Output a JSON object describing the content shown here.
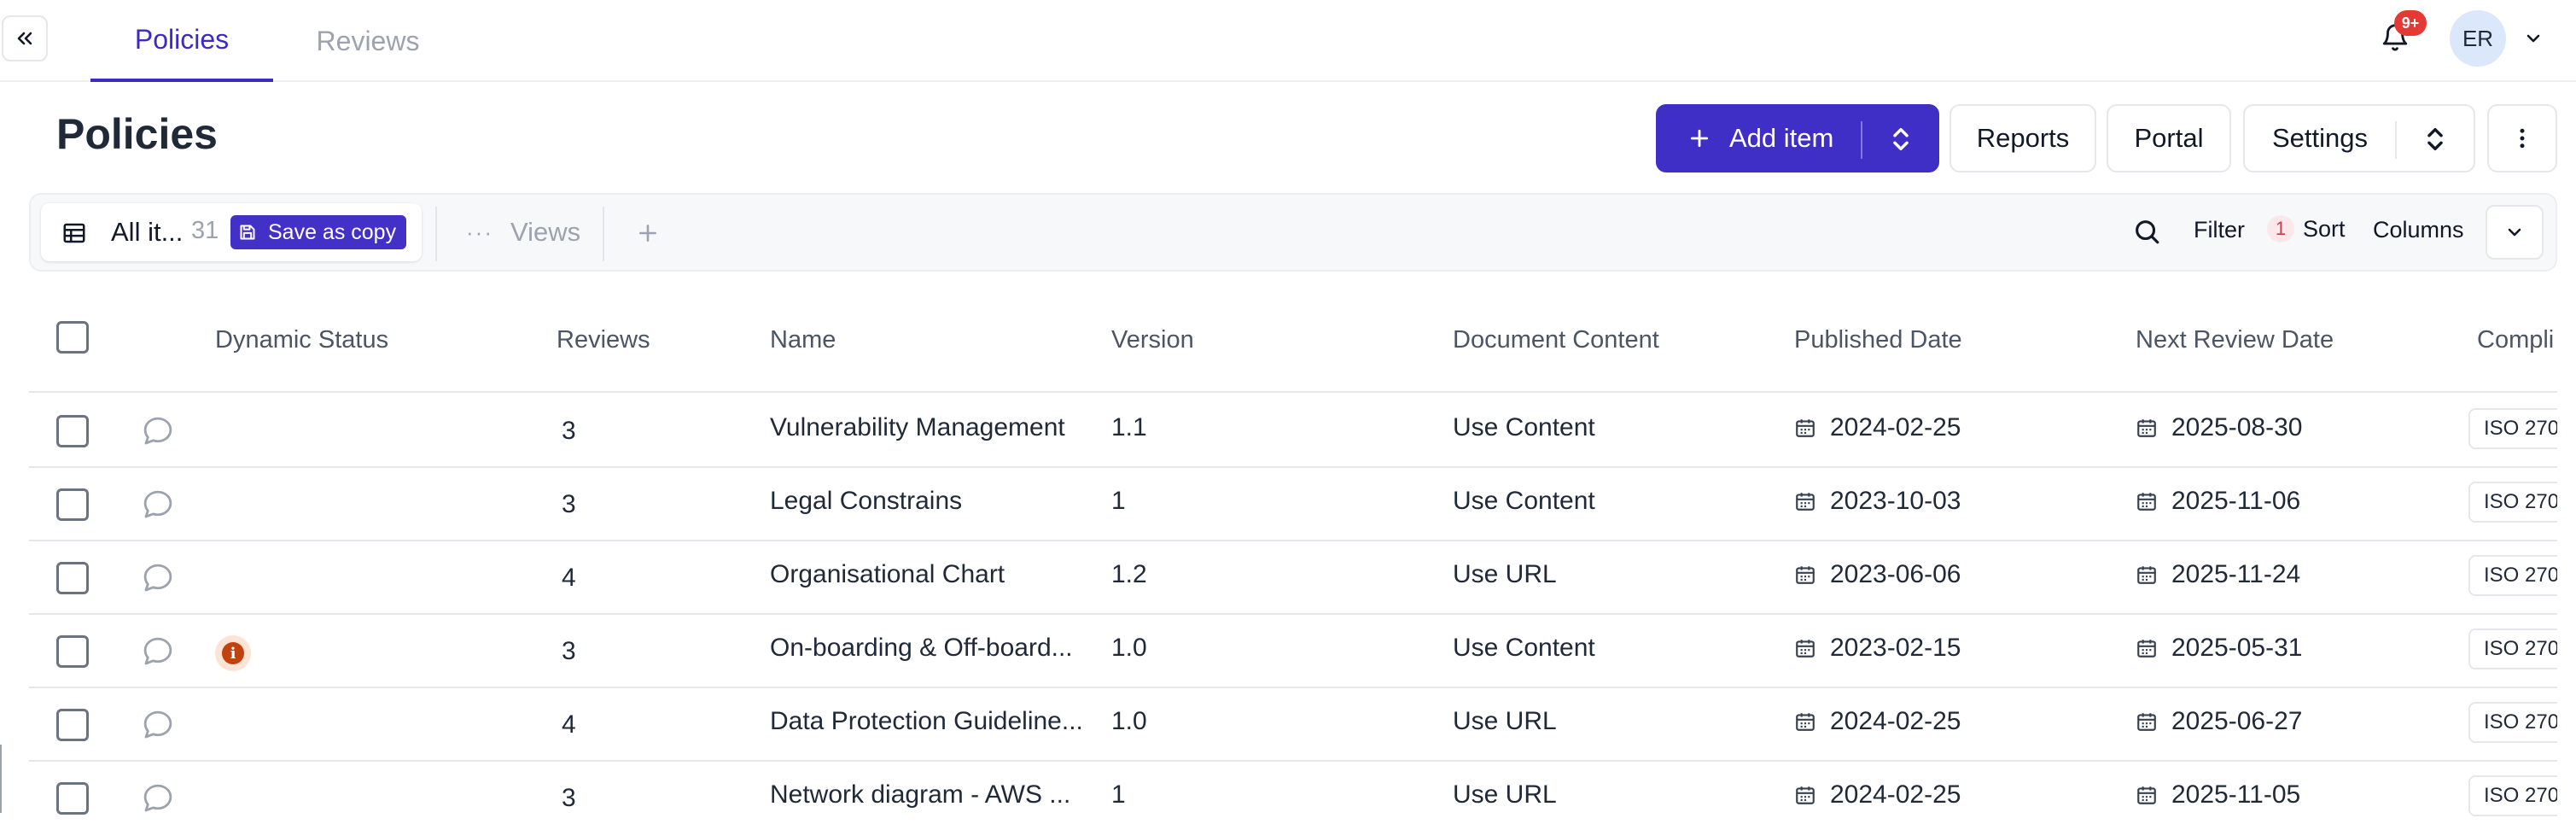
{
  "nav": {
    "collapse_icon": "double-chevron-left-icon",
    "tabs": [
      {
        "label": "Policies",
        "active": true
      },
      {
        "label": "Reviews",
        "active": false
      }
    ],
    "notification_badge": "9+",
    "avatar_initials": "ER"
  },
  "header": {
    "title": "Policies",
    "add_item_label": "Add item",
    "reports_label": "Reports",
    "portal_label": "Portal",
    "settings_label": "Settings"
  },
  "toolbar": {
    "view_name": "All it...",
    "view_count": "31",
    "save_copy_label": "Save as copy",
    "views_label": "Views",
    "filter_label": "Filter",
    "sort_count": "1",
    "sort_label": "Sort",
    "columns_label": "Columns"
  },
  "table": {
    "columns": [
      "Dynamic Status",
      "Reviews",
      "Name",
      "Version",
      "Document Content",
      "Published Date",
      "Next Review Date",
      "Compli"
    ],
    "rows": [
      {
        "status_icon": "",
        "reviews": "3",
        "name": "Vulnerability Management",
        "version": "1.1",
        "content": "Use Content",
        "published": "2024-02-25",
        "next_review": "2025-08-30",
        "compliance": "ISO 270"
      },
      {
        "status_icon": "",
        "reviews": "3",
        "name": "Legal Constrains",
        "version": "1",
        "content": "Use Content",
        "published": "2023-10-03",
        "next_review": "2025-11-06",
        "compliance": "ISO 270"
      },
      {
        "status_icon": "",
        "reviews": "4",
        "name": "Organisational Chart",
        "version": "1.2",
        "content": "Use URL",
        "published": "2023-06-06",
        "next_review": "2025-11-24",
        "compliance": "ISO 270"
      },
      {
        "status_icon": "info-icon",
        "reviews": "3",
        "name": "On-boarding & Off-board...",
        "version": "1.0",
        "content": "Use Content",
        "published": "2023-02-15",
        "next_review": "2025-05-31",
        "compliance": "ISO 270"
      },
      {
        "status_icon": "",
        "reviews": "4",
        "name": "Data Protection Guideline...",
        "version": "1.0",
        "content": "Use URL",
        "published": "2024-02-25",
        "next_review": "2025-06-27",
        "compliance": "ISO 270"
      },
      {
        "status_icon": "",
        "reviews": "3",
        "name": "Network diagram - AWS ...",
        "version": "1",
        "content": "Use URL",
        "published": "2024-02-25",
        "next_review": "2025-11-05",
        "compliance": "ISO 270"
      }
    ]
  },
  "colors": {
    "accent": "#3f2fc6",
    "notification": "#e53935",
    "warning": "#c2410c"
  }
}
